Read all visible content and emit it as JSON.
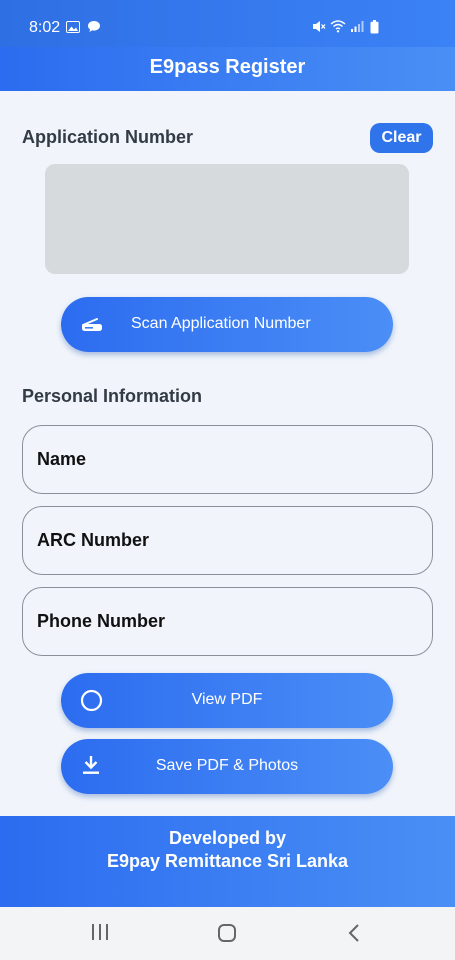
{
  "status": {
    "time": "8:02",
    "icons": [
      "gallery-icon",
      "chat-icon",
      "mute-icon",
      "wifi-icon",
      "signal-icon",
      "battery-icon"
    ]
  },
  "appbar": {
    "title": "E9pass Register"
  },
  "application": {
    "title": "Application Number",
    "clear_label": "Clear",
    "scan_label": "Scan Application Number"
  },
  "personal": {
    "title": "Personal Information",
    "fields": [
      {
        "label": "Name"
      },
      {
        "label": "ARC Number"
      },
      {
        "label": "Phone Number"
      }
    ]
  },
  "actions": {
    "view_pdf": "View PDF",
    "save_pdf": "Save PDF & Photos"
  },
  "footer": {
    "line1": "Developed by",
    "line2": "E9pay Remittance Sri Lanka"
  },
  "colors": {
    "primary": "#2f74ea",
    "background": "#f1f5fb",
    "placeholder_box": "#d7dadd"
  }
}
